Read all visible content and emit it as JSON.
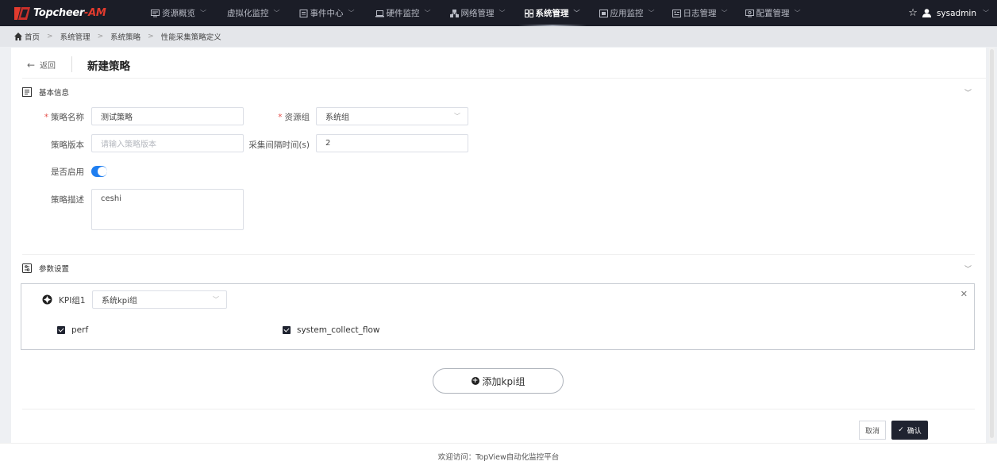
{
  "app": {
    "logo_text": "Topcheer",
    "logo_suffix": "-AM"
  },
  "nav": {
    "items": [
      {
        "label": "资源概览",
        "icon": "monitor-icon",
        "active": false
      },
      {
        "label": "虚拟化监控",
        "icon": "",
        "active": false
      },
      {
        "label": "事件中心",
        "icon": "document-icon",
        "active": false
      },
      {
        "label": "硬件监控",
        "icon": "laptop-icon",
        "active": false
      },
      {
        "label": "网络管理",
        "icon": "network-icon",
        "active": false
      },
      {
        "label": "系统管理",
        "icon": "grid-icon",
        "active": true
      },
      {
        "label": "应用监控",
        "icon": "window-icon",
        "active": false
      },
      {
        "label": "日志管理",
        "icon": "log-icon",
        "active": false
      },
      {
        "label": "配置管理",
        "icon": "config-icon",
        "active": false
      }
    ],
    "username": "sysadmin"
  },
  "breadcrumb": [
    "首页",
    "系统管理",
    "系统策略",
    "性能采集策略定义"
  ],
  "page": {
    "back_label": "返回",
    "title": "新建策略"
  },
  "basic_info": {
    "section_title": "基本信息",
    "policy_name_label": "策略名称",
    "policy_name_value": "测试策略",
    "resource_group_label": "资源组",
    "resource_group_value": "系统组",
    "policy_version_label": "策略版本",
    "policy_version_placeholder": "请输入策略版本",
    "interval_label": "采集间隔时间(s)",
    "interval_value": "2",
    "enabled_label": "是否启用",
    "enabled": true,
    "description_label": "策略描述",
    "description_value": "ceshi"
  },
  "params": {
    "section_title": "参数设置",
    "kpi_groups": [
      {
        "label": "KPI组1",
        "select_value": "系统kpi组",
        "checkboxes": [
          {
            "label": "perf",
            "checked": true
          },
          {
            "label": "system_collect_flow",
            "checked": true
          }
        ]
      }
    ],
    "add_button_label": "添加kpi组"
  },
  "actions": {
    "cancel_label": "取消",
    "confirm_label": "确认"
  },
  "footer": {
    "text": "欢迎访问：TopView自动化监控平台"
  },
  "colors": {
    "nav_bg": "#1b1d27",
    "accent": "#1f7ef0",
    "primary_button": "#1f2330",
    "logo_red": "#e23b2e"
  }
}
